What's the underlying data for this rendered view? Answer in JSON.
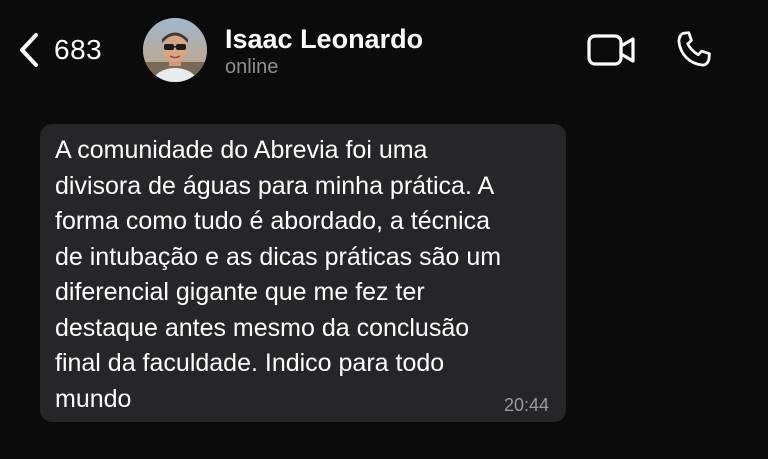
{
  "header": {
    "back_count": "683",
    "contact_name": "Isaac Leonardo",
    "contact_status": "online",
    "icons": {
      "back": "chevron-left-icon",
      "video": "video-camera-icon",
      "call": "phone-icon"
    }
  },
  "message": {
    "text": "A comunidade do Abrevia foi uma\ndivisora de águas para minha prática. A\nforma como tudo é abordado, a técnica\nde intubação e as dicas práticas são um\ndiferencial gigante que me fez ter\ndestaque antes mesmo da conclusão\nfinal da faculdade. Indico para todo\nmundo",
    "time": "20:44"
  },
  "colors": {
    "background": "#0b0b0b",
    "bubble": "#262628",
    "text": "#ffffff",
    "muted": "#8e8e93"
  }
}
